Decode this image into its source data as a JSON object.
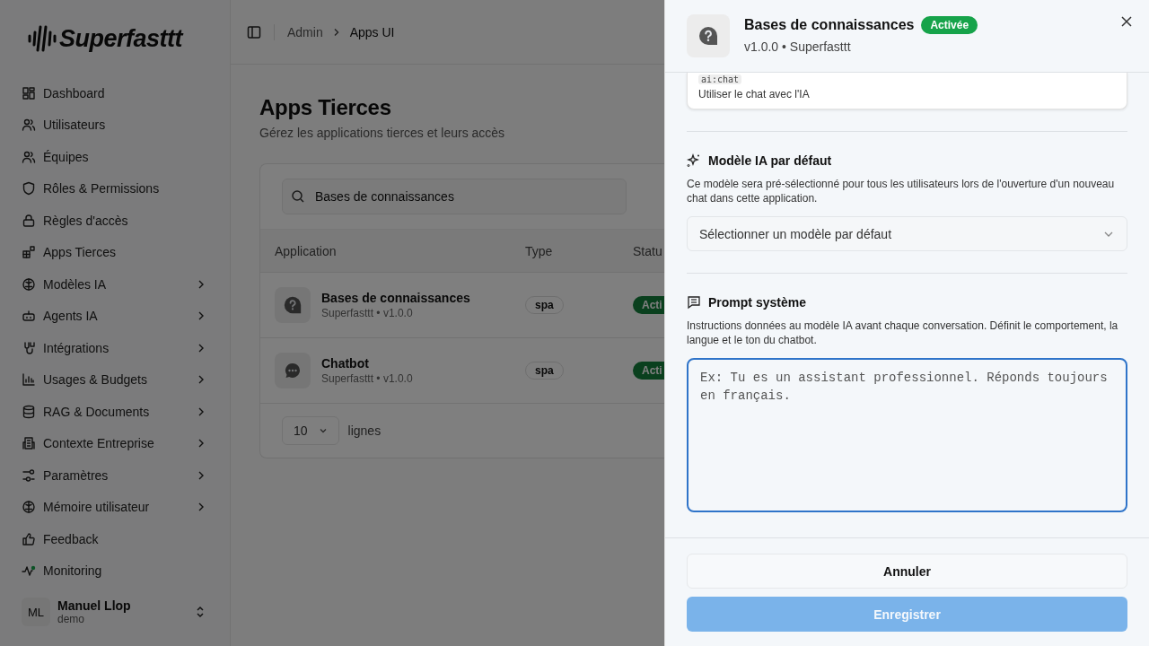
{
  "sidebar": {
    "logo": "Superfasttt",
    "items": [
      {
        "label": "Dashboard",
        "expandable": false
      },
      {
        "label": "Utilisateurs",
        "expandable": false
      },
      {
        "label": "Équipes",
        "expandable": false
      },
      {
        "label": "Rôles & Permissions",
        "expandable": false
      },
      {
        "label": "Règles d'accès",
        "expandable": false
      },
      {
        "label": "Apps Tierces",
        "expandable": false
      },
      {
        "label": "Modèles IA",
        "expandable": true
      },
      {
        "label": "Agents IA",
        "expandable": true
      },
      {
        "label": "Intégrations",
        "expandable": true
      },
      {
        "label": "Usages & Budgets",
        "expandable": true
      },
      {
        "label": "RAG & Documents",
        "expandable": true
      },
      {
        "label": "Contexte Entreprise",
        "expandable": true
      },
      {
        "label": "Paramètres",
        "expandable": true
      },
      {
        "label": "Mémoire utilisateur",
        "expandable": true
      },
      {
        "label": "Feedback",
        "expandable": false
      },
      {
        "label": "Monitoring",
        "expandable": false
      }
    ],
    "user": {
      "initials": "ML",
      "name": "Manuel Llop",
      "role": "demo"
    }
  },
  "breadcrumb": [
    "Admin",
    "Apps UI"
  ],
  "page": {
    "title": "Apps Tierces",
    "subtitle": "Gérez les applications tierces et leurs accès",
    "search": {
      "value": "Bases de connaissances"
    },
    "table": {
      "columns": [
        "Application",
        "Type",
        "Statu"
      ],
      "rows": [
        {
          "name": "Bases de connaissances",
          "meta": "Superfasttt • v1.0.0",
          "type": "spa",
          "status": "Acti"
        },
        {
          "name": "Chatbot",
          "meta": "Superfasttt • v1.0.0",
          "type": "spa",
          "status": "Acti"
        }
      ]
    },
    "pagination": {
      "page_size": "10",
      "label": "lignes"
    }
  },
  "drawer": {
    "title": "Bases de connaissances",
    "badge": "Activée",
    "subtitle": "v1.0.0 • Superfasttt",
    "scope": {
      "code": "ai:chat",
      "description": "Utiliser le chat avec l'IA"
    },
    "model_section": {
      "heading": "Modèle IA par défaut",
      "description": "Ce modèle sera pré-sélectionné pour tous les utilisateurs lors de l'ouverture d'un nouveau chat dans cette application.",
      "select": {
        "placeholder": "Sélectionner un modèle par défaut"
      }
    },
    "prompt_section": {
      "heading": "Prompt système",
      "description": "Instructions données au modèle IA avant chaque conversation. Définit le comportement, la langue et le ton du chatbot.",
      "textarea": {
        "placeholder": "Ex: Tu es un assistant professionnel. Réponds toujours en français."
      }
    },
    "buttons": [
      {
        "label": "Annuler",
        "kind": "secondary",
        "disabled": false
      },
      {
        "label": "Enregistrer",
        "kind": "primary",
        "disabled": true
      }
    ]
  }
}
